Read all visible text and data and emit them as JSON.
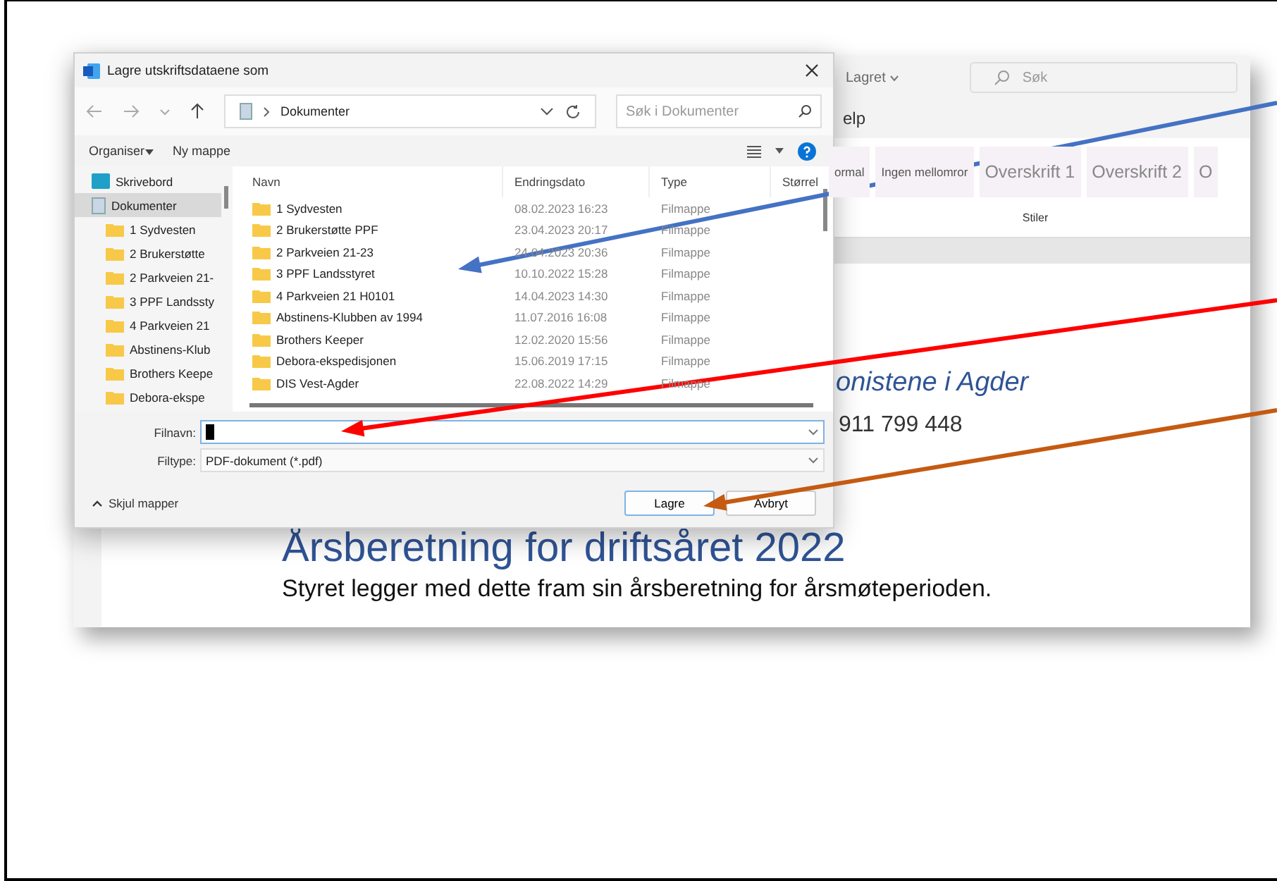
{
  "word_window": {
    "save_status": "Lagret",
    "search": {
      "placeholder": "Søk"
    },
    "ribbon_tab": "elp",
    "styles": [
      "ormal",
      "Ingen mellomror",
      "Overskrift 1",
      "Overskrift 2",
      "O"
    ],
    "styles_group_label": "Stiler",
    "document": {
      "org_name_fragment": "onistene i Agder",
      "phone": "911 799 448",
      "heading": "Årsberetning for driftsåret 2022",
      "body": "Styret legger med dette fram sin årsberetning for årsmøteperioden."
    }
  },
  "dialog": {
    "title": "Lagre utskriftsdataene som",
    "address": "Dokumenter",
    "search": {
      "placeholder": "Søk i Dokumenter"
    },
    "toolbar": [
      {
        "label": "Organiser",
        "kind": "menu"
      },
      {
        "label": "Ny mappe",
        "kind": "button"
      }
    ],
    "nav_items": [
      {
        "label": "Skrivebord",
        "kind": "desktop",
        "selected": false
      },
      {
        "label": "Dokumenter",
        "kind": "documents",
        "selected": true
      },
      {
        "label": "1 Sydvesten",
        "kind": "folder",
        "selected": false
      },
      {
        "label": "2 Brukerstøtte",
        "kind": "folder",
        "selected": false
      },
      {
        "label": "2 Parkveien 21-",
        "kind": "folder",
        "selected": false
      },
      {
        "label": "3 PPF Landssty",
        "kind": "folder",
        "selected": false
      },
      {
        "label": "4 Parkveien 21",
        "kind": "folder",
        "selected": false
      },
      {
        "label": "Abstinens-Klub",
        "kind": "folder",
        "selected": false
      },
      {
        "label": "Brothers Keepe",
        "kind": "folder",
        "selected": false
      },
      {
        "label": "Debora-ekspe",
        "kind": "folder",
        "selected": false
      }
    ],
    "columns": [
      "Navn",
      "Endringsdato",
      "Type",
      "Størrel"
    ],
    "rows": [
      {
        "name": "1 Sydvesten",
        "date": "08.02.2023 16:23",
        "type": "Filmappe"
      },
      {
        "name": "2 Brukerstøtte PPF",
        "date": "23.04.2023 20:17",
        "type": "Filmappe"
      },
      {
        "name": "2 Parkveien 21-23",
        "date": "24.04.2023 20:36",
        "type": "Filmappe"
      },
      {
        "name": "3 PPF Landsstyret",
        "date": "10.10.2022 15:28",
        "type": "Filmappe"
      },
      {
        "name": "4 Parkveien 21 H0101",
        "date": "14.04.2023 14:30",
        "type": "Filmappe"
      },
      {
        "name": "Abstinens-Klubben av 1994",
        "date": "11.07.2016 16:08",
        "type": "Filmappe"
      },
      {
        "name": "Brothers Keeper",
        "date": "12.02.2020 15:56",
        "type": "Filmappe"
      },
      {
        "name": "Debora-ekspedisjonen",
        "date": "15.06.2019 17:15",
        "type": "Filmappe"
      },
      {
        "name": "DIS Vest-Agder",
        "date": "22.08.2022 14:29",
        "type": "Filmappe"
      }
    ],
    "filename": {
      "label": "Filnavn:"
    },
    "filetype": {
      "label": "Filtype:",
      "value": "PDF-dokument (*.pdf)"
    },
    "hide_folders": "Skjul mapper",
    "buttons": [
      {
        "label": "Lagre",
        "kind": "primary"
      },
      {
        "label": "Avbryt",
        "kind": "secondary"
      }
    ]
  },
  "annotations": [
    {
      "color": "#4472c4"
    },
    {
      "color": "#ff0000"
    },
    {
      "color": "#c55a11"
    }
  ]
}
